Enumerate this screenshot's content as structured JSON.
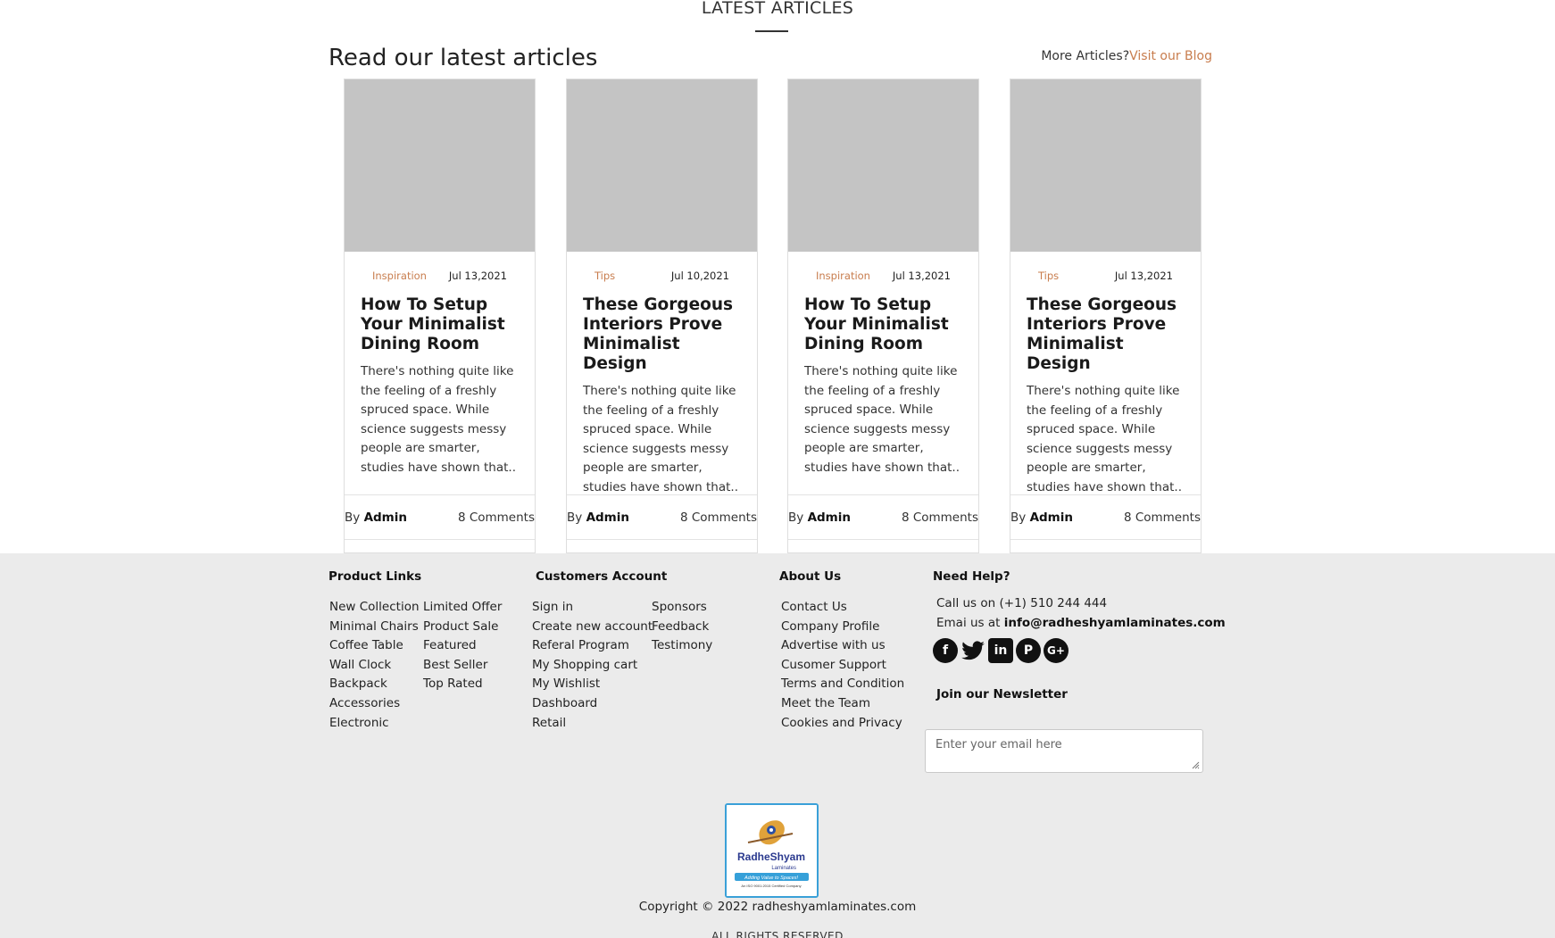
{
  "articles": {
    "eyebrow": "LATEST ARTICLES",
    "title": "Read our latest articles",
    "more_text": "More Articles?",
    "more_link": "Visit our Blog",
    "cards": [
      {
        "category": "Inspiration",
        "date": "Jul 13,2021",
        "title": "How To Setup Your Minimalist Dining Room",
        "excerpt": "There's nothing quite like the feeling of a freshly spruced space. While science suggests messy people are smarter, studies have shown that..",
        "by": "By",
        "author": "Admin",
        "comments": "8 Comments"
      },
      {
        "category": "Tips",
        "date": "Jul 10,2021",
        "title": "These Gorgeous Interiors Prove Minimalist Design",
        "excerpt": "There's nothing quite like the feeling of a freshly spruced space. While science suggests messy people are smarter, studies have shown that..",
        "by": "By",
        "author": "Admin",
        "comments": "8 Comments"
      },
      {
        "category": "Inspiration",
        "date": "Jul 13,2021",
        "title": "How To Setup Your Minimalist Dining Room",
        "excerpt": "There's nothing quite like the feeling of a freshly spruced space. While science suggests messy people are smarter, studies have shown that..",
        "by": "By",
        "author": "Admin",
        "comments": "8 Comments"
      },
      {
        "category": "Tips",
        "date": "Jul 13,2021",
        "title": "These Gorgeous Interiors Prove Minimalist Design",
        "excerpt": "There's nothing quite like the feeling of a freshly spruced space. While science suggests messy people are smarter, studies have shown that..",
        "by": "By",
        "author": "Admin",
        "comments": "8 Comments"
      }
    ]
  },
  "footer": {
    "product_links": {
      "heading": "Product Links",
      "col1": [
        "New Collection",
        "Minimal Chairs",
        "Coffee Table",
        "Wall Clock",
        "Backpack",
        "Accessories",
        "Electronic"
      ],
      "col2": [
        "Limited Offer",
        "Product Sale",
        "Featured",
        "Best Seller",
        "Top Rated"
      ]
    },
    "customers_account": {
      "heading": "Customers Account",
      "col1": [
        "Sign in",
        "Create new account",
        "Referal Program",
        "My Shopping cart",
        "My Wishlist",
        "Dashboard",
        "Retail"
      ],
      "col2": [
        "Sponsors",
        "Feedback",
        "Testimony"
      ]
    },
    "about_us": {
      "heading": "About Us",
      "items": [
        "Contact Us",
        "Company Profile",
        "Advertise with us",
        "Cusomer Support",
        "Terms and Condition",
        "Meet the Team",
        "Cookies and Privacy"
      ]
    },
    "help": {
      "heading": "Need Help?",
      "call_prefix": "Call us on",
      "phone": "(+1) 510 244 444",
      "email_prefix": "Emai us at",
      "email": "info@radheshyamlaminates.com",
      "socials": [
        "facebook-icon",
        "twitter-icon",
        "linkedin-icon",
        "pinterest-icon",
        "google-plus-icon"
      ]
    },
    "newsletter": {
      "heading": "Join our Newsletter",
      "placeholder": "Enter your email here"
    },
    "logo": {
      "brand": "RadheShyam",
      "sub": "Laminates",
      "tagline": "Adding Value to Spaces!",
      "cert": "An ISO 9001:2015 Certified Company"
    },
    "copyright": "Copyright © 2022 radheshyamlaminates.com",
    "rights": "ALL RIGHTS RESERVED"
  },
  "colors": {
    "accent": "#c87d4e",
    "footer_bg": "#ebebeb",
    "thumb": "#c4c4c4"
  }
}
